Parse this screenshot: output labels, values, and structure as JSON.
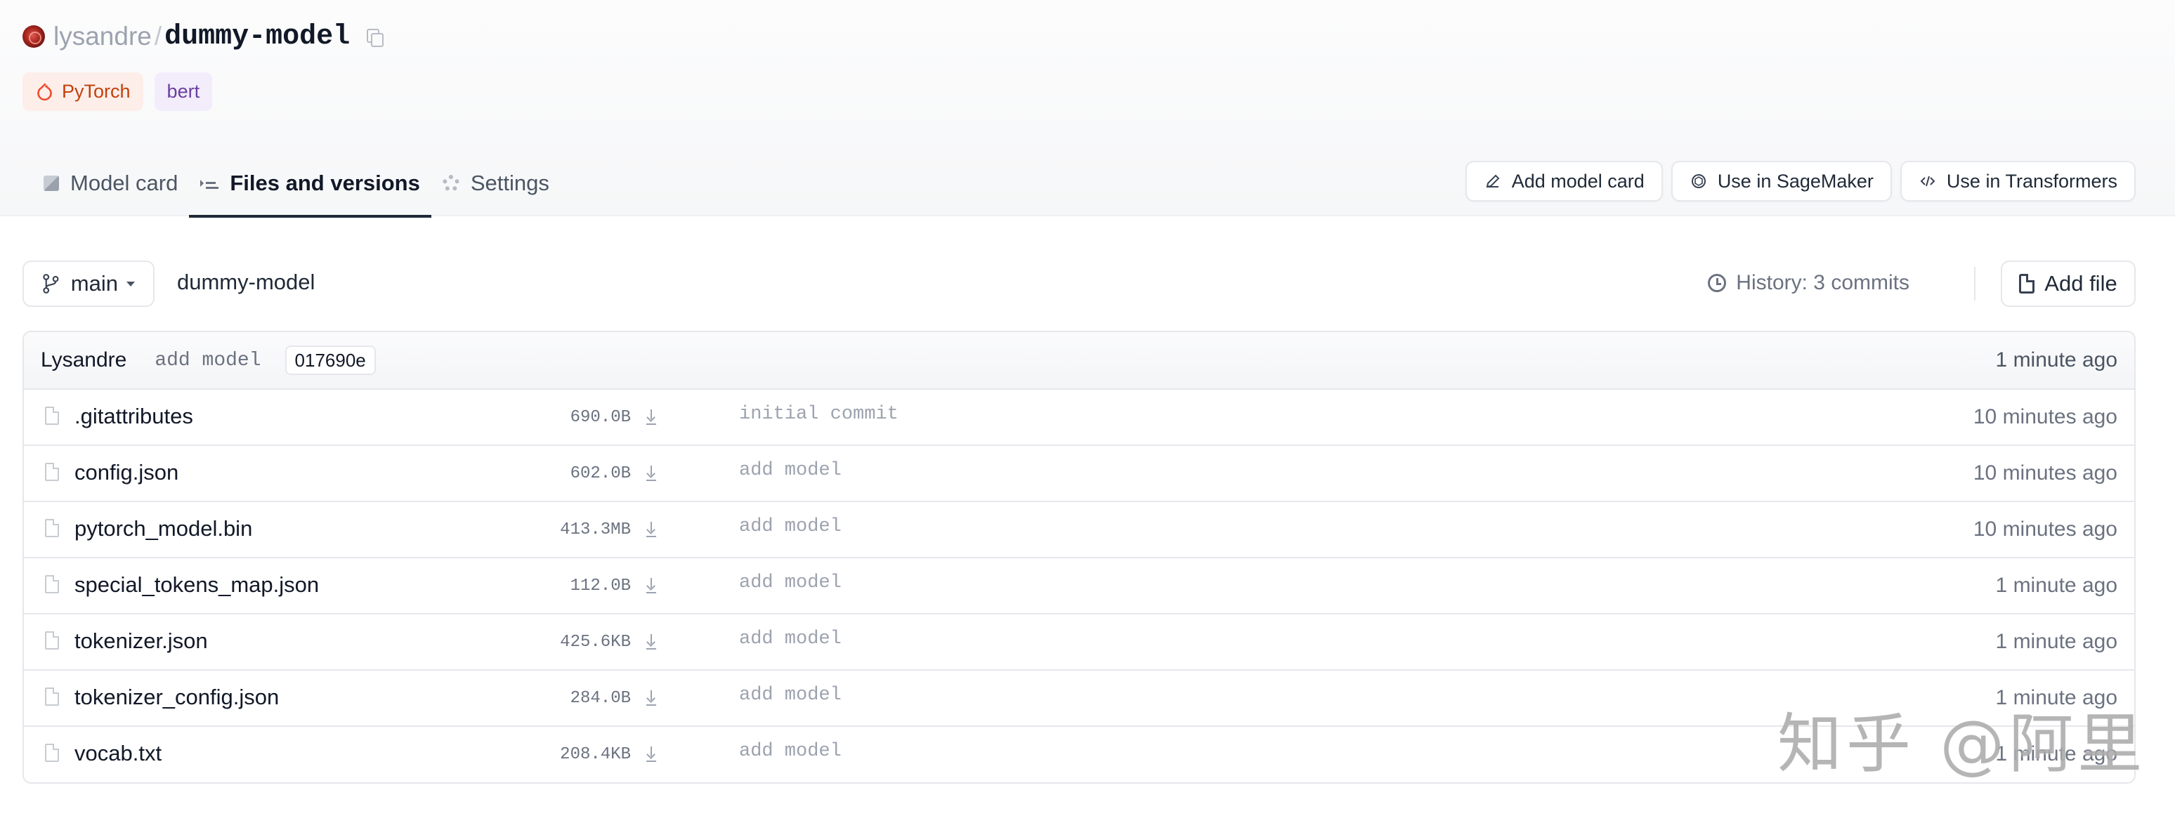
{
  "repo": {
    "owner": "lysandre",
    "separator": "/",
    "name": "dummy-model"
  },
  "tags": [
    {
      "label": "PyTorch",
      "icon": "pytorch-icon",
      "color": "#c2410c"
    },
    {
      "label": "bert",
      "color": "#6b3fa0"
    }
  ],
  "tabs": [
    {
      "label": "Model card",
      "icon": "cube-icon"
    },
    {
      "label": "Files and versions",
      "icon": "files-icon",
      "active": true
    },
    {
      "label": "Settings",
      "icon": "gear-icon"
    }
  ],
  "actions": [
    {
      "label": "Add model card",
      "icon": "pencil-icon"
    },
    {
      "label": "Use in SageMaker",
      "icon": "sagemaker-icon"
    },
    {
      "label": "Use in Transformers",
      "icon": "code-icon"
    }
  ],
  "branch": {
    "name": "main",
    "path": "dummy-model",
    "history": "History: 3 commits",
    "add_file": "Add file"
  },
  "last_commit": {
    "author": "Lysandre",
    "message": "add model",
    "sha": "017690e",
    "time": "1 minute ago"
  },
  "files": [
    {
      "name": ".gitattributes",
      "size": "690.0B",
      "message": "initial commit",
      "time": "10 minutes ago"
    },
    {
      "name": "config.json",
      "size": "602.0B",
      "message": "add model",
      "time": "10 minutes ago"
    },
    {
      "name": "pytorch_model.bin",
      "size": "413.3MB",
      "message": "add model",
      "time": "10 minutes ago"
    },
    {
      "name": "special_tokens_map.json",
      "size": "112.0B",
      "message": "add model",
      "time": "1 minute ago"
    },
    {
      "name": "tokenizer.json",
      "size": "425.6KB",
      "message": "add model",
      "time": "1 minute ago"
    },
    {
      "name": "tokenizer_config.json",
      "size": "284.0B",
      "message": "add model",
      "time": "1 minute ago"
    },
    {
      "name": "vocab.txt",
      "size": "208.4KB",
      "message": "add model",
      "time": "1 minute ago"
    }
  ],
  "watermark": "知乎 @阿里"
}
